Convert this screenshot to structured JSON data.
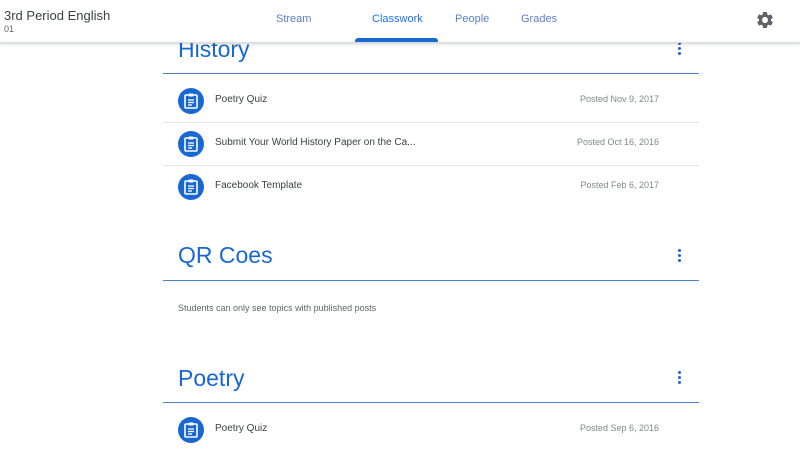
{
  "header": {
    "class_title": "3rd Period English",
    "class_section": "01",
    "tabs": [
      {
        "label": "Stream"
      },
      {
        "label": "Classwork"
      },
      {
        "label": "People"
      },
      {
        "label": "Grades"
      }
    ],
    "active_tab": "Classwork",
    "settings_icon": "gear-icon"
  },
  "topics": [
    {
      "title": "History",
      "menu_icon": "more-vert-icon",
      "items": [
        {
          "title": "Poetry Quiz",
          "date": "Posted Nov 9, 2017",
          "icon": "assignment-icon"
        },
        {
          "title": "Submit Your World History Paper on the Ca...",
          "date": "Posted Oct 16, 2016",
          "icon": "assignment-icon"
        },
        {
          "title": "Facebook Template",
          "date": "Posted Feb 6, 2017",
          "icon": "assignment-icon"
        }
      ]
    },
    {
      "title": "QR Coes",
      "menu_icon": "more-vert-icon",
      "note": "Students can only see topics with published posts",
      "items": []
    },
    {
      "title": "Poetry",
      "menu_icon": "more-vert-icon",
      "items": [
        {
          "title": "Poetry Quiz",
          "date": "Posted Sep 6, 2016",
          "icon": "assignment-icon"
        }
      ]
    }
  ],
  "colors": {
    "accent": "#1967d2",
    "tab_inactive": "#5a7fc4",
    "divider": "#e3e3e3"
  }
}
